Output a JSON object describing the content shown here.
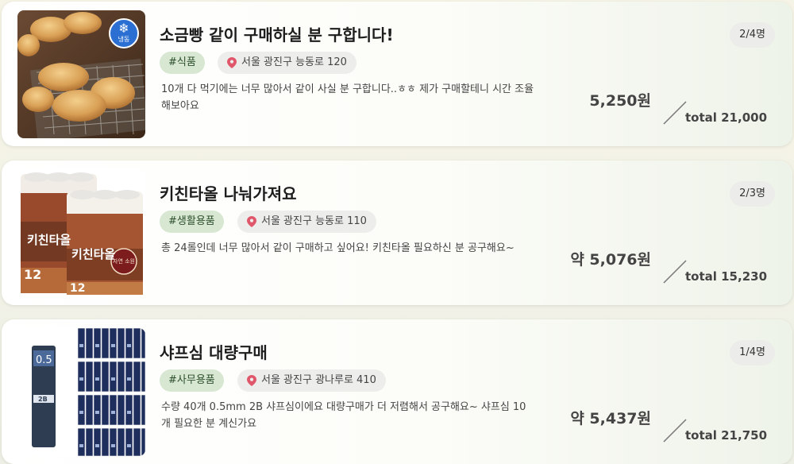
{
  "posts": [
    {
      "title": "소금빵 같이 구매하실 분 구합니다!",
      "count": "2/4명",
      "tag": "#식품",
      "location": "서울 광진구 능동로 120",
      "description": "10개 다 먹기에는 너무 많아서 같이 사실 분 구합니다..ㅎㅎ 제가 구매할테니 시간 조율 해보아요",
      "price": "5,250원",
      "total": "total 21,000",
      "thumb_badge": "냉동",
      "thumb_icon": "snowflake-icon"
    },
    {
      "title": "키친타올 나눠가져요",
      "count": "2/3명",
      "tag": "#생활용품",
      "location": "서울 광진구 능동로 110",
      "description": "총 24롤인데 너무 많아서 같이 구매하고 싶어요! 키친타올 필요하신 분 공구해요~",
      "price": "약 5,076원",
      "total": "total 15,230",
      "thumb_text": "키친타올",
      "thumb_sub": "자연 소원"
    },
    {
      "title": "샤프심 대량구매",
      "count": "1/4명",
      "tag": "#사무용품",
      "location": "서울 광진구 광나루로 410",
      "description": "수량 40개 0.5mm 2B 샤프심이에요 대량구매가 더 저렴해서 공구해요~ 샤프심 10개 필요한 분 계신가요",
      "price": "약 5,437원",
      "total": "total 21,750",
      "thumb_text": "0.5",
      "thumb_sub": "2B"
    }
  ],
  "colors": {
    "tag_bg": "#d7e7d2",
    "tag_text": "#2e4f2e",
    "pin": "#e0566b"
  }
}
